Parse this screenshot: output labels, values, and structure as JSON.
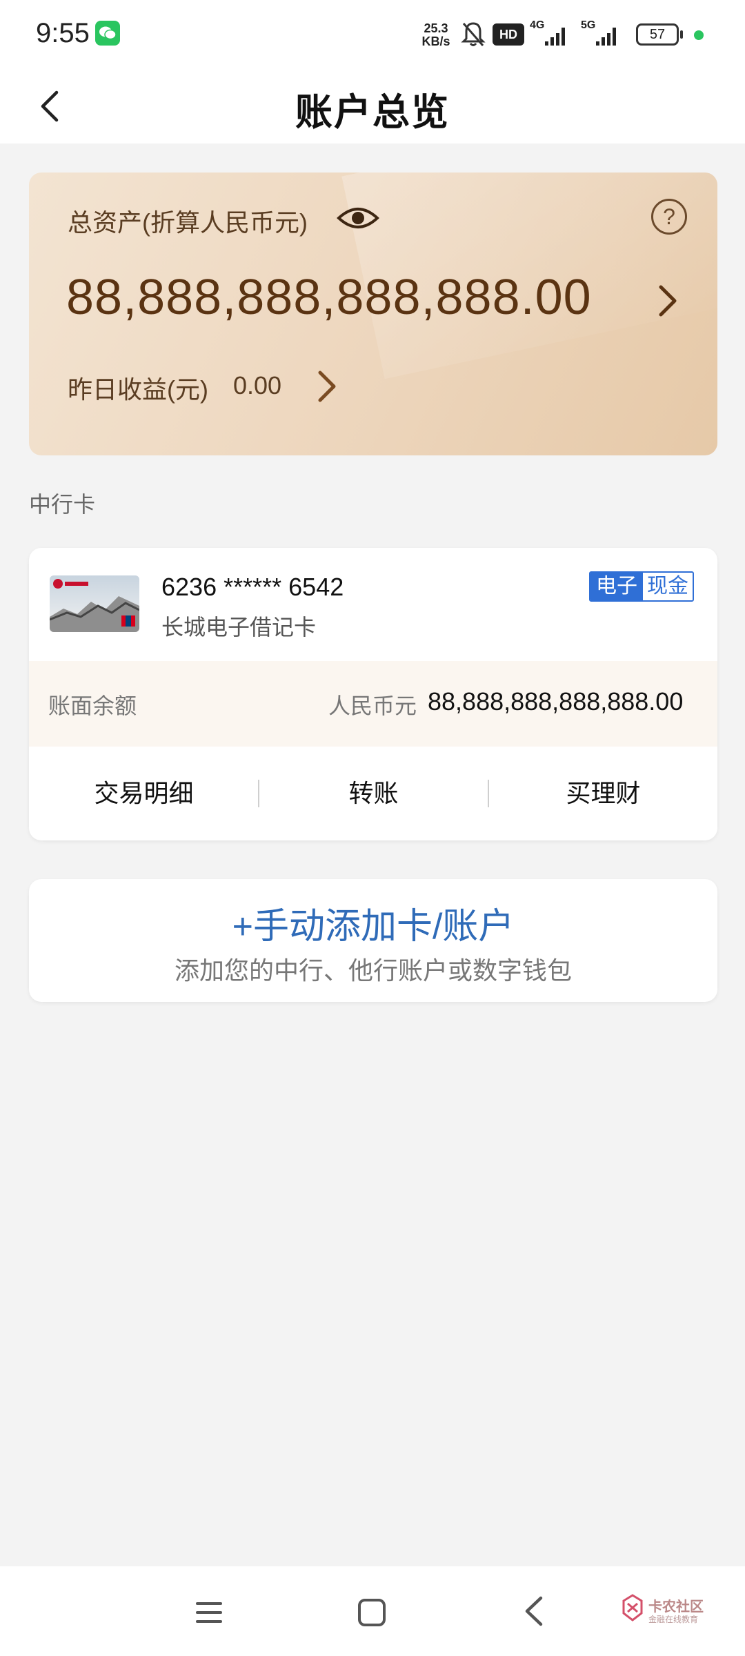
{
  "status_bar": {
    "time": "9:55",
    "net_speed_value": "25.3",
    "net_speed_unit": "KB/s",
    "hd_label": "HD",
    "signal_1_label": "4G",
    "signal_2_label": "5G",
    "battery_level": "57",
    "icons": [
      "wechat-icon",
      "mute-icon",
      "signal-icon",
      "battery-icon"
    ]
  },
  "header": {
    "title": "账户总览"
  },
  "asset_card": {
    "label": "总资产(折算人民币元)",
    "amount": "88,888,888,888,888.00",
    "income_label": "昨日收益(元)",
    "income_value": "0.00",
    "help_symbol": "?"
  },
  "section": {
    "title": "中行卡"
  },
  "bank_card": {
    "number": "6236 ****** 6542",
    "type": "长城电子借记卡",
    "badge_part1": "电子",
    "badge_part2": "现金",
    "balance_label": "账面余额",
    "balance_currency": "人民币元",
    "balance_amount": "88,888,888,888,888.00",
    "actions": [
      "交易明细",
      "转账",
      "买理财"
    ]
  },
  "add_card": {
    "title": "+手动添加卡/账户",
    "subtitle": "添加您的中行、他行账户或数字钱包"
  },
  "nav_bar": {
    "watermark_text": "卡农社区",
    "watermark_sub": "金融在线教育"
  },
  "colors": {
    "accent_blue": "#2f6bb8",
    "asset_text": "#5a3312",
    "badge_blue": "#2f6fd6",
    "wechat_green": "#2ac55f"
  }
}
